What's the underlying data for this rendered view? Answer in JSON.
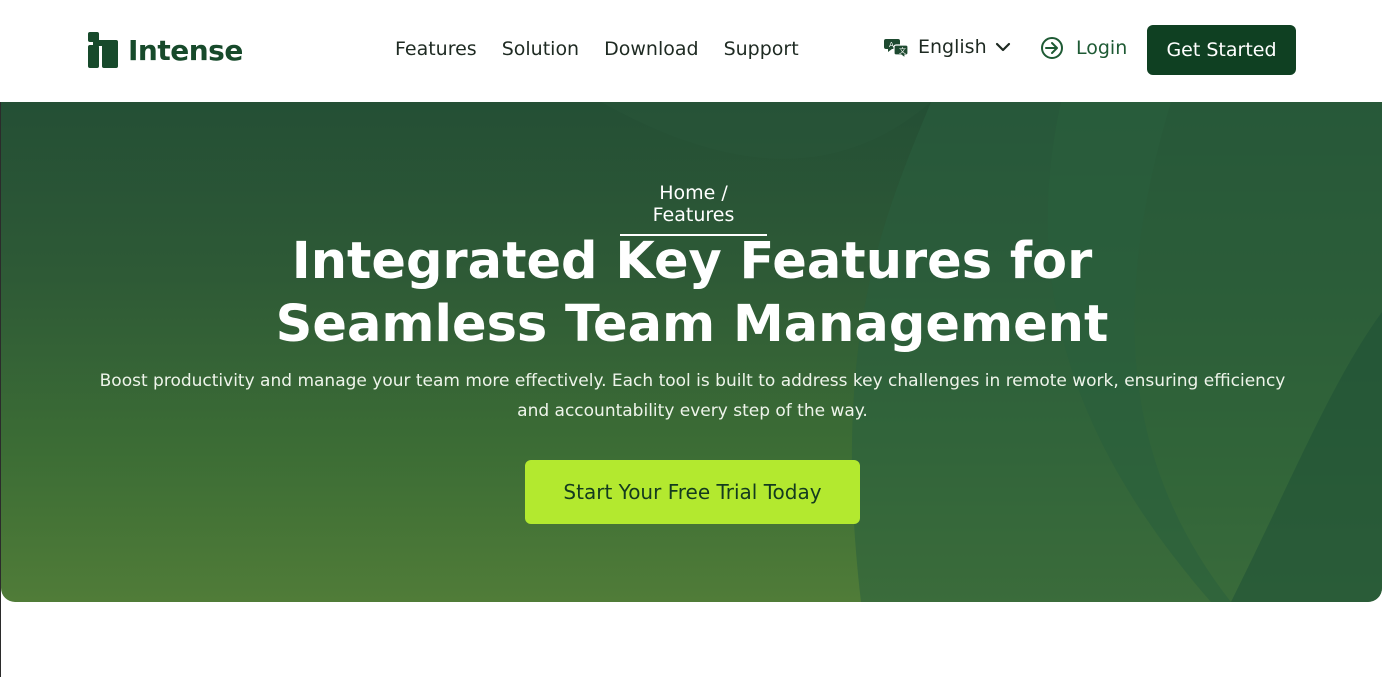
{
  "brand": {
    "name": "Intense",
    "color": "#174a2b"
  },
  "nav": {
    "items": [
      {
        "label": "Features"
      },
      {
        "label": "Solution"
      },
      {
        "label": "Download"
      },
      {
        "label": "Support"
      }
    ]
  },
  "language": {
    "icon": "translate-icon",
    "label": "English",
    "chevron": "chevron-down-icon"
  },
  "login": {
    "icon": "login-arrow-icon",
    "label": "Login"
  },
  "get_started": {
    "label": "Get Started",
    "color": "#0f4022"
  },
  "hero": {
    "breadcrumb": {
      "home": "Home",
      "separator": " / ",
      "current": "Features"
    },
    "title_line1": "Integrated Key Features for",
    "title_line2": "Seamless Team Management",
    "subtitle": "Boost productivity and manage your team more effectively. Each tool is built to address key challenges in remote work, ensuring efficiency and accountability every step of the way.",
    "cta": {
      "label": "Start Your Free Trial Today",
      "color": "#b3e92f"
    }
  }
}
